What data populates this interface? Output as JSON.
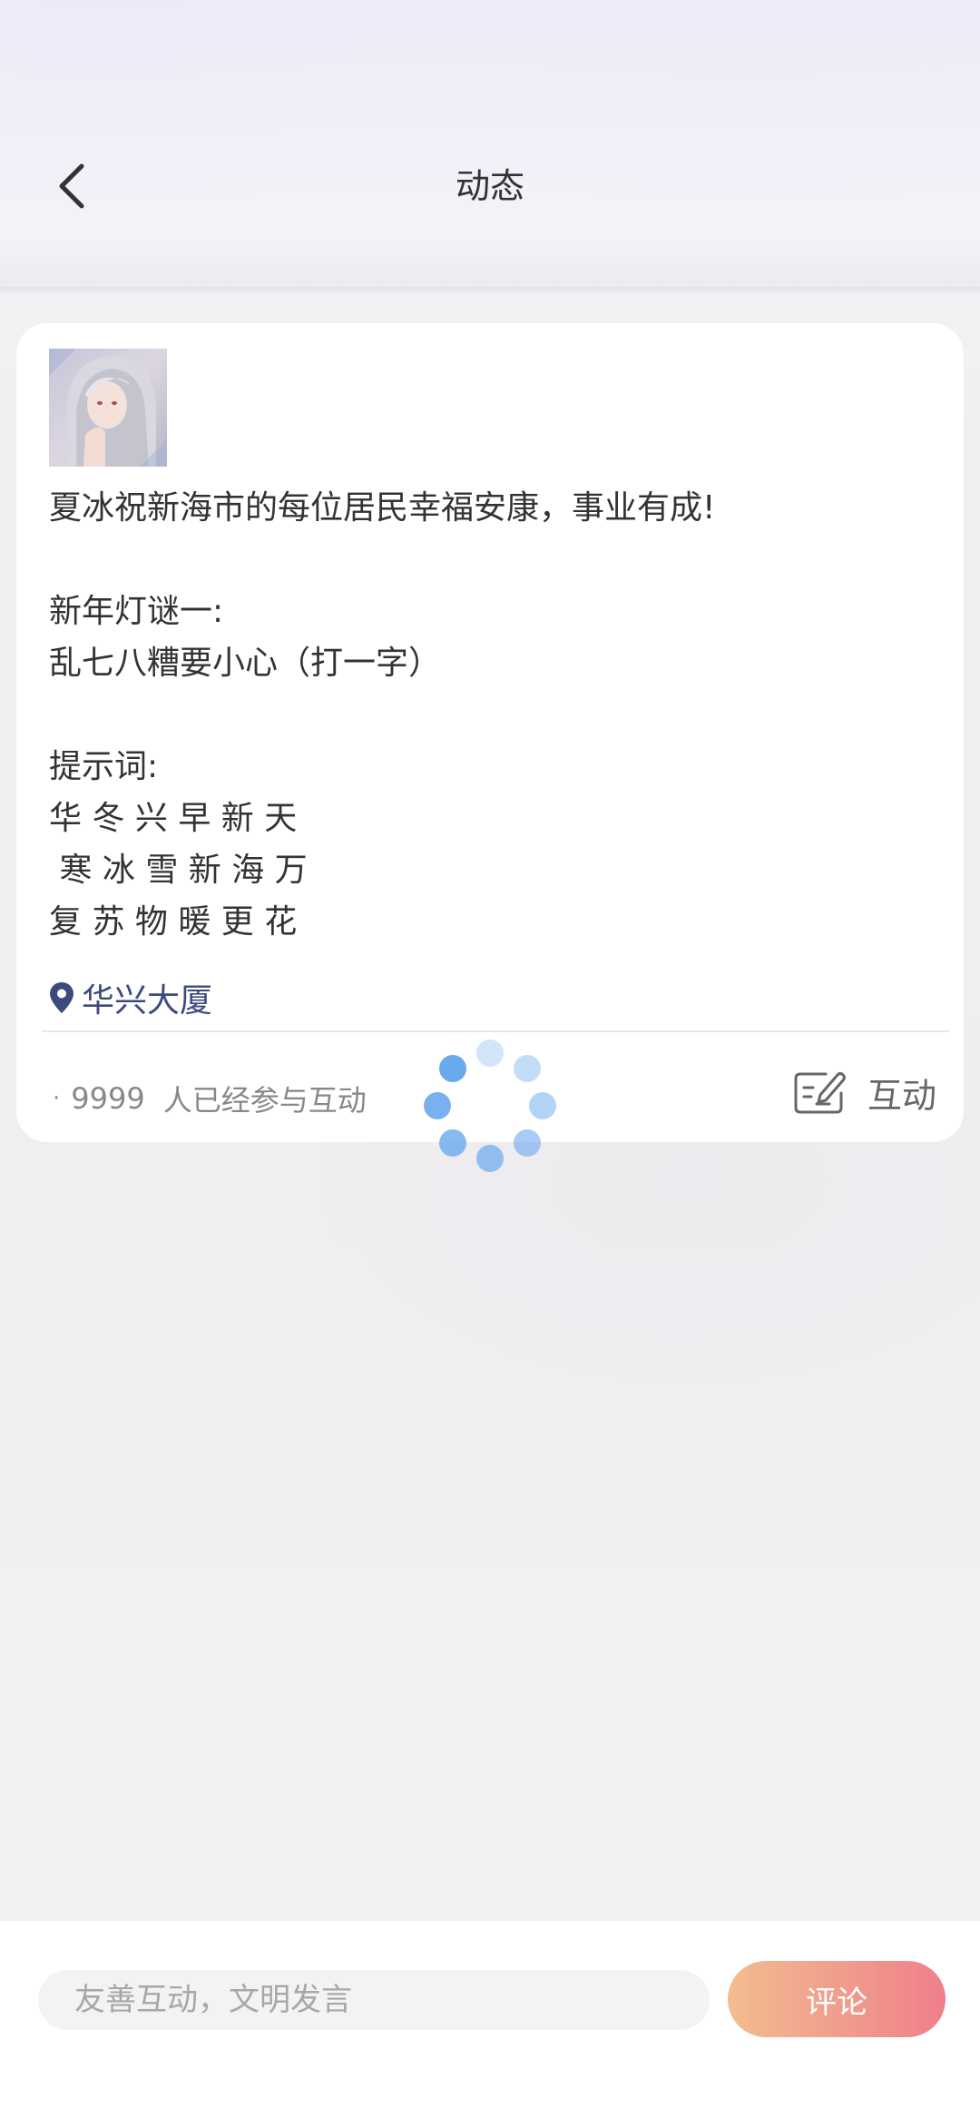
{
  "header": {
    "title": "动态",
    "back_icon": "chevron-left-icon"
  },
  "post": {
    "avatar_icon": "avatar-anime-girl",
    "lines": [
      "夏冰祝新海市的每位居民幸福安康，事业有成!",
      "",
      "新年灯谜一:",
      "乱七八糟要小心（打一字）",
      "",
      "提示词:",
      "华 冬 兴 早 新 天",
      " 寒 冰 雪 新 海 万",
      "复 苏 物 暖 更 花"
    ],
    "location": "华兴大厦",
    "location_icon": "map-pin-icon",
    "participants_dot": "·",
    "participants_count": "9999",
    "participants_text": "人已经参与互动",
    "interact_label": "互动",
    "interact_icon": "edit-note-icon"
  },
  "comment_bar": {
    "placeholder": "友善互动，文明发言",
    "submit_label": "评论"
  },
  "colors": {
    "accent_start": "#f3bd8f",
    "accent_end": "#ef7f8b",
    "location": "#3c4a7e",
    "spinner": "#6aa9ec"
  }
}
